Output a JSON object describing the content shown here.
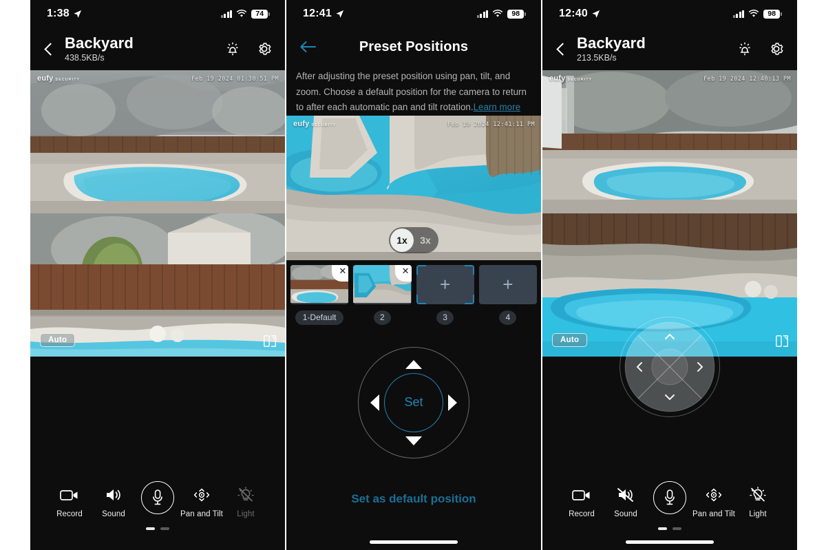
{
  "theme": {
    "accent": "#1f86b4",
    "link": "#2a7fa8",
    "panel_bg": "#0d0d0d",
    "slot_bg": "#394350",
    "page_bg": "#ffffff"
  },
  "panels": [
    {
      "id": "live-view-left",
      "status_bar": {
        "time": "1:38",
        "location_icon": "location-arrow-icon",
        "signal_icon": "cellular-bars-icon",
        "wifi_icon": "wifi-icon",
        "battery": "74"
      },
      "header": {
        "back_icon": "chevron-left-icon",
        "title": "Backyard",
        "subtitle": "438.5KB/s",
        "alarm_icon": "siren-alarm-icon",
        "settings_icon": "gear-icon"
      },
      "video_top": {
        "watermark": "eufy",
        "watermark_sub": "SECURITY",
        "timestamp": "Feb 19 2024  01:30:51 PM"
      },
      "video_bottom": {
        "auto_badge": "Auto",
        "dual_view_icon": "dual-view-icon"
      },
      "toolbar": [
        {
          "label": "Record",
          "icon": "video-camera-icon",
          "state": "enabled"
        },
        {
          "label": "Sound",
          "icon": "speaker-on-icon",
          "state": "enabled"
        },
        {
          "label": "",
          "icon": "microphone-icon",
          "state": "enabled"
        },
        {
          "label": "Pan and Tilt",
          "icon": "pan-tilt-icon",
          "state": "enabled"
        },
        {
          "label": "Light",
          "icon": "light-off-icon",
          "state": "disabled"
        }
      ],
      "page_dots": {
        "count": 2,
        "active_index": 0
      }
    },
    {
      "id": "preset-positions",
      "status_bar": {
        "time": "12:41",
        "location_icon": "location-arrow-icon",
        "signal_icon": "cellular-bars-icon",
        "wifi_icon": "wifi-icon",
        "battery": "98"
      },
      "header": {
        "back_icon": "arrow-left-icon",
        "title": "Preset Positions"
      },
      "description": {
        "text": "After adjusting the preset position using pan, tilt, and zoom. Choose a default position for the camera to return to after each automatic pan and tilt rotation.",
        "link_label": "Learn more"
      },
      "video": {
        "watermark": "eufy",
        "watermark_sub": "SECURITY",
        "timestamp": "Feb 19 2024  12:41:11 PM"
      },
      "zoom_levels": [
        {
          "label": "1x",
          "selected": true
        },
        {
          "label": "3x",
          "selected": false
        }
      ],
      "presets": [
        {
          "label": "1-Default",
          "filled": true,
          "selected": false,
          "delete_icon": "close-icon"
        },
        {
          "label": "2",
          "filled": true,
          "selected": false,
          "delete_icon": "close-icon"
        },
        {
          "label": "3",
          "filled": false,
          "selected": true,
          "add_icon": "plus-icon"
        },
        {
          "label": "4",
          "filled": false,
          "selected": false,
          "add_icon": "plus-icon"
        }
      ],
      "dpad": {
        "center_label": "Set",
        "up_icon": "triangle-up-icon",
        "down_icon": "triangle-down-icon",
        "left_icon": "triangle-left-icon",
        "right_icon": "triangle-right-icon"
      },
      "set_default_label": "Set as default position"
    },
    {
      "id": "live-view-right",
      "status_bar": {
        "time": "12:40",
        "location_icon": "location-arrow-icon",
        "signal_icon": "cellular-bars-icon",
        "wifi_icon": "wifi-icon",
        "battery": "98"
      },
      "header": {
        "back_icon": "chevron-left-icon",
        "title": "Backyard",
        "subtitle": "213.5KB/s",
        "alarm_icon": "siren-alarm-icon",
        "settings_icon": "gear-icon"
      },
      "video_top": {
        "watermark": "eufy",
        "watermark_sub": "SECURITY",
        "timestamp": "Feb 19 2024  12:40:13 PM"
      },
      "video_bottom": {
        "auto_badge": "Auto",
        "dual_view_icon": "dual-view-icon"
      },
      "joystick": {
        "up_icon": "chevron-up-icon",
        "down_icon": "chevron-down-icon",
        "left_icon": "chevron-left-icon",
        "right_icon": "chevron-right-icon"
      },
      "toolbar": [
        {
          "label": "Record",
          "icon": "video-camera-icon",
          "state": "enabled"
        },
        {
          "label": "Sound",
          "icon": "speaker-muted-icon",
          "state": "enabled"
        },
        {
          "label": "",
          "icon": "microphone-icon",
          "state": "enabled"
        },
        {
          "label": "Pan and Tilt",
          "icon": "pan-tilt-icon",
          "state": "enabled"
        },
        {
          "label": "Light",
          "icon": "light-off-icon",
          "state": "enabled"
        }
      ],
      "page_dots": {
        "count": 2,
        "active_index": 0
      }
    }
  ]
}
